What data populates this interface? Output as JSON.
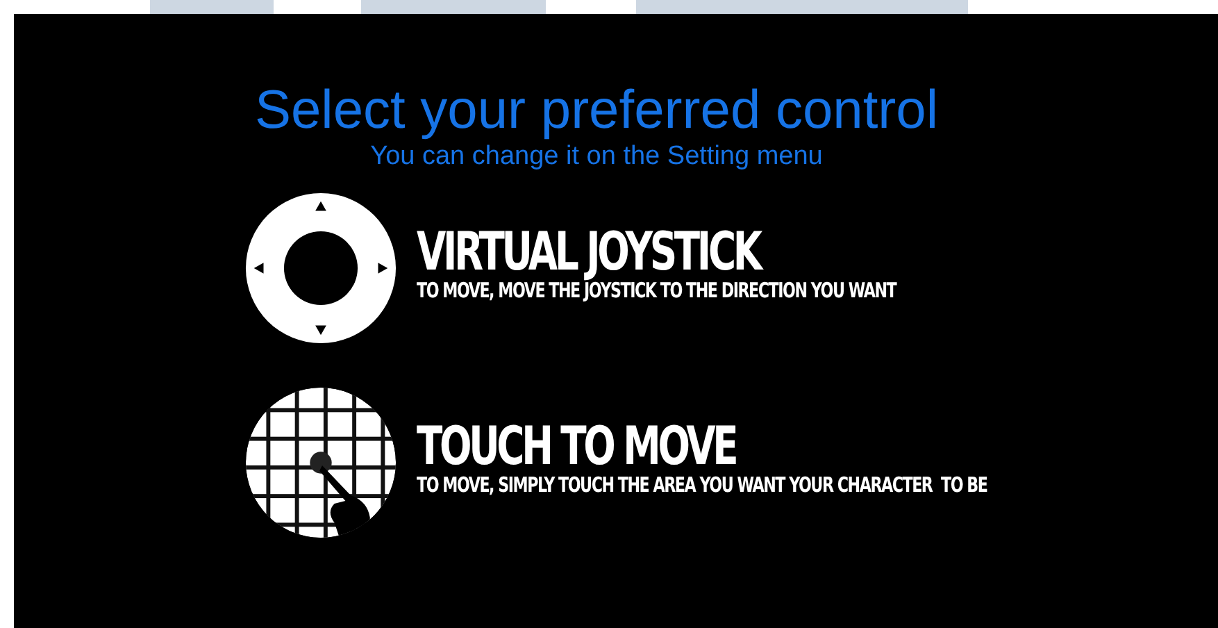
{
  "title": "Select your preferred control",
  "subtitle": "You can change it on the Setting menu",
  "options": [
    {
      "kind": "joystick",
      "heading": "VIRTUAL JOYSTICK",
      "description": "TO MOVE, MOVE THE JOYSTICK TO THE DIRECTION YOU WANT"
    },
    {
      "kind": "touch",
      "heading": "TOUCH TO MOVE",
      "description": "TO MOVE, SIMPLY TOUCH THE AREA YOU WANT YOUR CHARACTER  TO BE"
    }
  ]
}
